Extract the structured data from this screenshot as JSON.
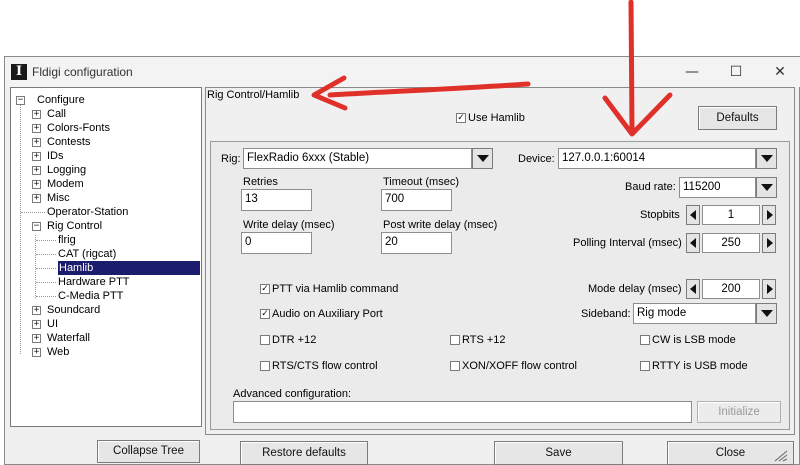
{
  "window": {
    "title": "Fldigi configuration",
    "icon_glyph": "I",
    "minimize": "—",
    "maximize": "☐",
    "close": "✕"
  },
  "tree": {
    "root": "Configure",
    "items": [
      {
        "label": "Call",
        "expander": "+"
      },
      {
        "label": "Colors-Fonts",
        "expander": "+"
      },
      {
        "label": "Contests",
        "expander": "+"
      },
      {
        "label": "IDs",
        "expander": "+"
      },
      {
        "label": "Logging",
        "expander": "+"
      },
      {
        "label": "Modem",
        "expander": "+"
      },
      {
        "label": "Misc",
        "expander": "+"
      },
      {
        "label": "Operator-Station",
        "expander": ""
      },
      {
        "label": "Rig Control",
        "expander": "−"
      },
      {
        "label": "flrig",
        "expander": ""
      },
      {
        "label": "CAT (rigcat)",
        "expander": ""
      },
      {
        "label": "Hamlib",
        "expander": "",
        "selected": true
      },
      {
        "label": "Hardware PTT",
        "expander": ""
      },
      {
        "label": "C-Media PTT",
        "expander": ""
      },
      {
        "label": "Soundcard",
        "expander": "+"
      },
      {
        "label": "UI",
        "expander": "+"
      },
      {
        "label": "Waterfall",
        "expander": "+"
      },
      {
        "label": "Web",
        "expander": "+"
      }
    ],
    "root_expander": "−"
  },
  "panel": {
    "heading": "Rig Control/Hamlib",
    "use_hamlib": {
      "label": "Use Hamlib",
      "checked": true
    },
    "defaults_button": "Defaults",
    "rig": {
      "label": "Rig:",
      "value": "FlexRadio 6xxx  (Stable)"
    },
    "device": {
      "label": "Device:",
      "value": "127.0.0.1:60014"
    },
    "retries": {
      "label": "Retries",
      "value": "13"
    },
    "timeout": {
      "label": "Timeout (msec)",
      "value": "700"
    },
    "write_delay": {
      "label": "Write delay (msec)",
      "value": "0"
    },
    "post_write_delay": {
      "label": "Post write delay (msec)",
      "value": "20"
    },
    "baud_rate": {
      "label": "Baud rate:",
      "value": "115200"
    },
    "stopbits": {
      "label": "Stopbits",
      "value": "1"
    },
    "polling_interval": {
      "label": "Polling Interval (msec)",
      "value": "250"
    },
    "mode_delay": {
      "label": "Mode delay (msec)",
      "value": "200"
    },
    "sideband": {
      "label": "Sideband:",
      "value": "Rig mode"
    },
    "ptt_hamlib": {
      "label": "PTT via Hamlib command",
      "checked": true
    },
    "audio_aux": {
      "label": "Audio on Auxiliary Port",
      "checked": true
    },
    "dtr": {
      "label": "DTR +12",
      "checked": false
    },
    "rts": {
      "label": "RTS +12",
      "checked": false
    },
    "cw_lsb": {
      "label": "CW is LSB mode",
      "checked": false
    },
    "rts_cts": {
      "label": "RTS/CTS flow control",
      "checked": false
    },
    "xon_xoff": {
      "label": "XON/XOFF flow control",
      "checked": false
    },
    "rtty_usb": {
      "label": "RTTY is USB mode",
      "checked": false
    },
    "advanced": {
      "label": "Advanced configuration:",
      "value": ""
    },
    "initialize_button": "Initialize"
  },
  "footer": {
    "collapse_tree": "Collapse Tree",
    "restore_defaults": "Restore defaults",
    "save": "Save",
    "close": "Close"
  },
  "annotations": {
    "arrow_color": "#e0302a"
  },
  "checkmark": "✓"
}
